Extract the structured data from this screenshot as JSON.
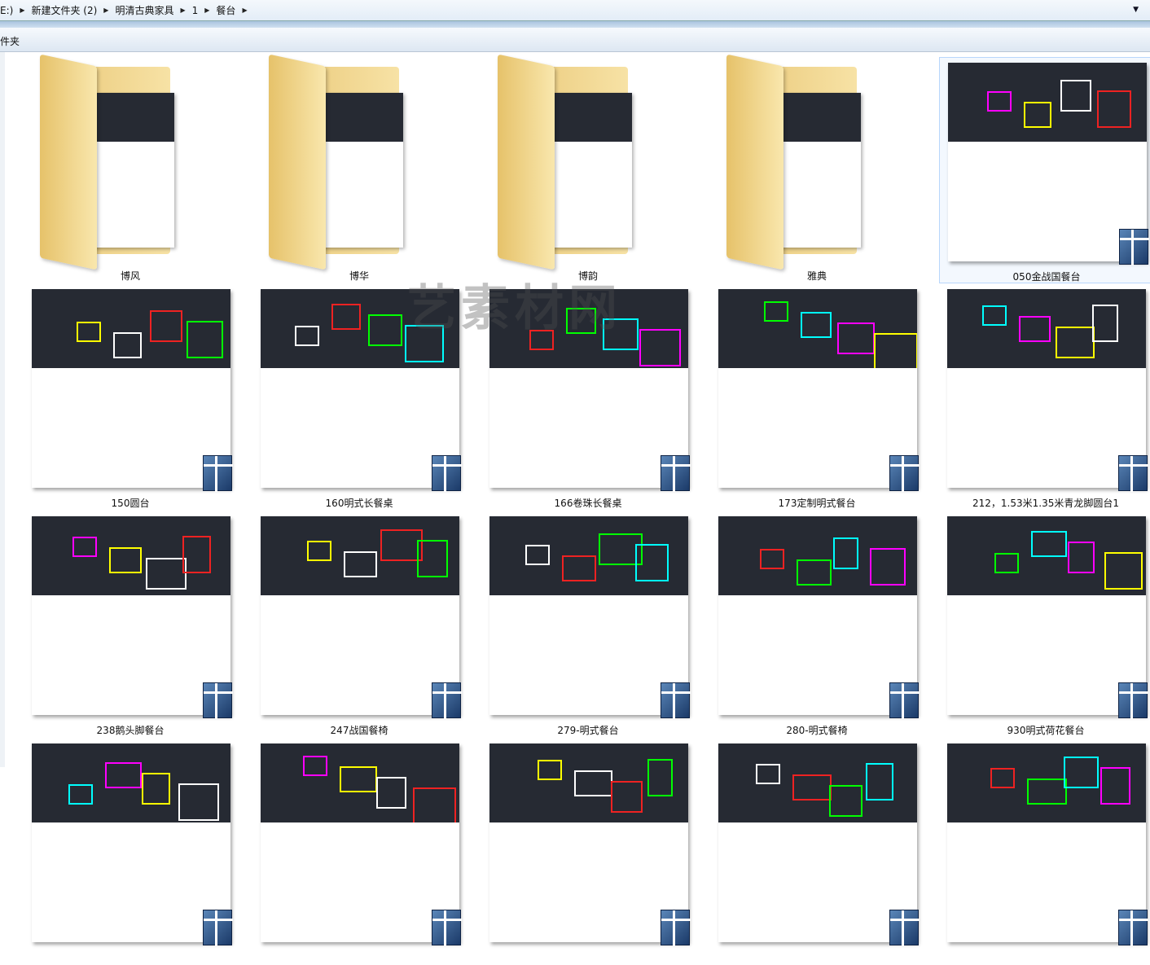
{
  "breadcrumb": [
    "E:)",
    "新建文件夹 (2)",
    "明清古典家具",
    "1",
    "餐台"
  ],
  "toolbar": {
    "label": "件夹"
  },
  "watermark": "艺素材网",
  "items": [
    {
      "label": "博风",
      "type": "folder"
    },
    {
      "label": "博华",
      "type": "folder"
    },
    {
      "label": "博韵",
      "type": "folder"
    },
    {
      "label": "雅典",
      "type": "folder"
    },
    {
      "label": "050金战国餐台",
      "type": "dwg",
      "selected": true
    },
    {
      "label": "150圆台",
      "type": "dwg"
    },
    {
      "label": "160明式长餐桌",
      "type": "dwg"
    },
    {
      "label": "166卷珠长餐桌",
      "type": "dwg"
    },
    {
      "label": "173定制明式餐台",
      "type": "dwg"
    },
    {
      "label": "212，1.53米1.35米青龙脚圆台1",
      "type": "dwg"
    },
    {
      "label": "238鹅头脚餐台",
      "type": "dwg"
    },
    {
      "label": "247战国餐椅",
      "type": "dwg"
    },
    {
      "label": "279-明式餐台",
      "type": "dwg"
    },
    {
      "label": "280-明式餐椅",
      "type": "dwg"
    },
    {
      "label": "930明式荷花餐台",
      "type": "dwg"
    },
    {
      "label": "",
      "type": "dwg"
    },
    {
      "label": "",
      "type": "dwg"
    },
    {
      "label": "",
      "type": "dwg"
    },
    {
      "label": "",
      "type": "dwg"
    },
    {
      "label": "",
      "type": "dwg"
    }
  ]
}
